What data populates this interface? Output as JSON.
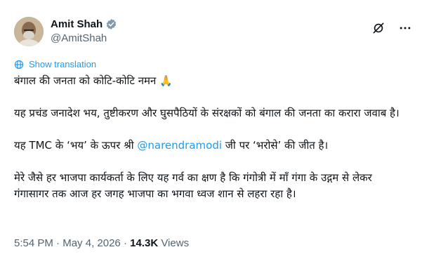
{
  "author": {
    "name": "Amit Shah",
    "handle": "@AmitShah"
  },
  "header": {
    "grok_icon": "grok-icon",
    "more_icon": "more-icon"
  },
  "translate_label": "Show translation",
  "tweet": {
    "line1": "बंगाल की जनता को कोटि-कोटि नमन 🙏",
    "para2": "यह प्रचंड जनादेश भय, तुष्टीकरण और घुसपैठियों के संरक्षकों को बंगाल की जनता का करारा जवाब है।",
    "para3_before": "यह TMC के ‘भय’ के ऊपर श्री ",
    "para3_mention": "@narendramodi",
    "para3_after": " जी पर ‘भरोसे’ की जीत है।",
    "para4": "मेरे जैसे हर भाजपा कार्यकर्ता के लिए यह गर्व का क्षण है कि गंगोत्री में माँ गंगा के उद्गम से लेकर गंगासागर तक आज हर जगह भाजपा का भगवा ध्वज शान से लहरा रहा है।"
  },
  "meta": {
    "time": "5:54 PM",
    "date": "May 4, 2026",
    "views_count": "14.3K",
    "views_label": "Views",
    "separator": "·"
  },
  "colors": {
    "accent": "#1d9bf0",
    "text": "#0f1419",
    "muted": "#536471",
    "verified_badge": "#829aab"
  }
}
